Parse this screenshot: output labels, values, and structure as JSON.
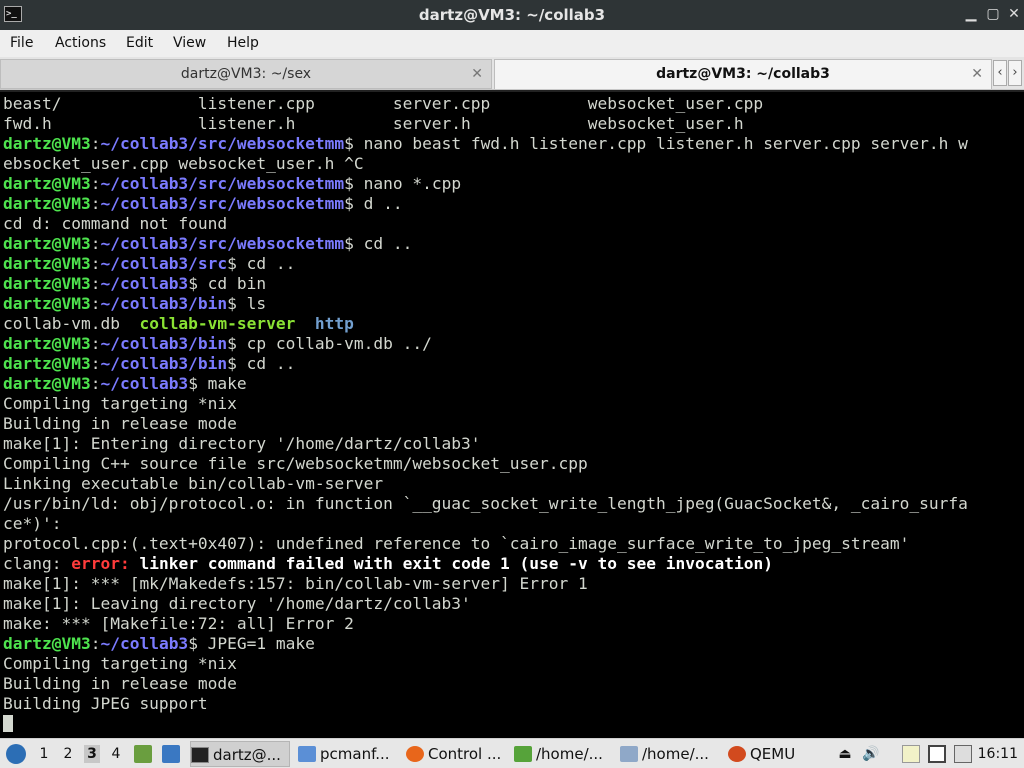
{
  "window": {
    "title": "dartz@VM3: ~/collab3",
    "app_icon_text": ">_"
  },
  "menu": [
    "File",
    "Actions",
    "Edit",
    "View",
    "Help"
  ],
  "tabs": [
    {
      "label": "dartz@VM3: ~/sex",
      "active": false
    },
    {
      "label": "dartz@VM3: ~/collab3",
      "active": true
    }
  ],
  "terminal": {
    "lines": [
      [
        {
          "t": "beast/              listener.cpp        server.cpp          websocket_user.cpp"
        }
      ],
      [
        {
          "t": "fwd.h               listener.h          server.h            websocket_user.h"
        }
      ],
      [
        {
          "t": "dartz@VM3",
          "c": "g"
        },
        {
          "t": ":"
        },
        {
          "t": "~/collab3/src/websocketmm",
          "c": "b"
        },
        {
          "t": "$ nano beast fwd.h listener.cpp listener.h server.cpp server.h w"
        }
      ],
      [
        {
          "t": "ebsocket_user.cpp websocket_user.h ^C"
        }
      ],
      [
        {
          "t": "dartz@VM3",
          "c": "g"
        },
        {
          "t": ":"
        },
        {
          "t": "~/collab3/src/websocketmm",
          "c": "b"
        },
        {
          "t": "$ nano *.cpp"
        }
      ],
      [
        {
          "t": "dartz@VM3",
          "c": "g"
        },
        {
          "t": ":"
        },
        {
          "t": "~/collab3/src/websocketmm",
          "c": "b"
        },
        {
          "t": "$ d .."
        }
      ],
      [
        {
          "t": "cd d: command not found"
        }
      ],
      [
        {
          "t": "dartz@VM3",
          "c": "g"
        },
        {
          "t": ":"
        },
        {
          "t": "~/collab3/src/websocketmm",
          "c": "b"
        },
        {
          "t": "$ cd .."
        }
      ],
      [
        {
          "t": "dartz@VM3",
          "c": "g"
        },
        {
          "t": ":"
        },
        {
          "t": "~/collab3/src",
          "c": "b"
        },
        {
          "t": "$ cd .."
        }
      ],
      [
        {
          "t": "dartz@VM3",
          "c": "g"
        },
        {
          "t": ":"
        },
        {
          "t": "~/collab3",
          "c": "b"
        },
        {
          "t": "$ cd bin"
        }
      ],
      [
        {
          "t": "dartz@VM3",
          "c": "g"
        },
        {
          "t": ":"
        },
        {
          "t": "~/collab3/bin",
          "c": "b"
        },
        {
          "t": "$ ls"
        }
      ],
      [
        {
          "t": "collab-vm.db  "
        },
        {
          "t": "collab-vm-server",
          "c": "exe"
        },
        {
          "t": "  "
        },
        {
          "t": "http",
          "c": "dir"
        }
      ],
      [
        {
          "t": "dartz@VM3",
          "c": "g"
        },
        {
          "t": ":"
        },
        {
          "t": "~/collab3/bin",
          "c": "b"
        },
        {
          "t": "$ cp collab-vm.db ../"
        }
      ],
      [
        {
          "t": "dartz@VM3",
          "c": "g"
        },
        {
          "t": ":"
        },
        {
          "t": "~/collab3/bin",
          "c": "b"
        },
        {
          "t": "$ cd .."
        }
      ],
      [
        {
          "t": "dartz@VM3",
          "c": "g"
        },
        {
          "t": ":"
        },
        {
          "t": "~/collab3",
          "c": "b"
        },
        {
          "t": "$ make"
        }
      ],
      [
        {
          "t": "Compiling targeting *nix"
        }
      ],
      [
        {
          "t": "Building in release mode"
        }
      ],
      [
        {
          "t": "make[1]: Entering directory '/home/dartz/collab3'"
        }
      ],
      [
        {
          "t": "Compiling C++ source file src/websocketmm/websocket_user.cpp"
        }
      ],
      [
        {
          "t": "Linking executable bin/collab-vm-server"
        }
      ],
      [
        {
          "t": "/usr/bin/ld: obj/protocol.o: in function `__guac_socket_write_length_jpeg(GuacSocket&, _cairo_surfa"
        }
      ],
      [
        {
          "t": "ce*)':"
        }
      ],
      [
        {
          "t": "protocol.cpp:(.text+0x407): undefined reference to `cairo_image_surface_write_to_jpeg_stream'"
        }
      ],
      [
        {
          "t": "clang: "
        },
        {
          "t": "error: ",
          "c": "r"
        },
        {
          "t": "linker command failed with exit code 1 (use -v to see invocation)",
          "c": "w"
        }
      ],
      [
        {
          "t": "make[1]: *** [mk/Makedefs:157: bin/collab-vm-server] Error 1"
        }
      ],
      [
        {
          "t": "make[1]: Leaving directory '/home/dartz/collab3'"
        }
      ],
      [
        {
          "t": "make: *** [Makefile:72: all] Error 2"
        }
      ],
      [
        {
          "t": "dartz@VM3",
          "c": "g"
        },
        {
          "t": ":"
        },
        {
          "t": "~/collab3",
          "c": "b"
        },
        {
          "t": "$ JPEG=1 make"
        }
      ],
      [
        {
          "t": "Compiling targeting *nix"
        }
      ],
      [
        {
          "t": "Building in release mode"
        }
      ],
      [
        {
          "t": "Building JPEG support"
        }
      ]
    ]
  },
  "taskbar": {
    "desktops": [
      "1",
      "2",
      "3",
      "4"
    ],
    "active_desktop": "3",
    "tasks": [
      {
        "label": "dartz@...",
        "icon": "terminal-icon",
        "active": true
      },
      {
        "label": "pcmanf...",
        "icon": "folder-icon",
        "active": false
      },
      {
        "label": "Control ...",
        "icon": "firefox-icon",
        "active": false
      },
      {
        "label": "/home/...",
        "icon": "editor-icon",
        "active": false
      },
      {
        "label": "/home/...",
        "icon": "text-editor-icon",
        "active": false
      },
      {
        "label": "QEMU",
        "icon": "qemu-icon",
        "active": false
      }
    ],
    "clock": "16:11"
  }
}
